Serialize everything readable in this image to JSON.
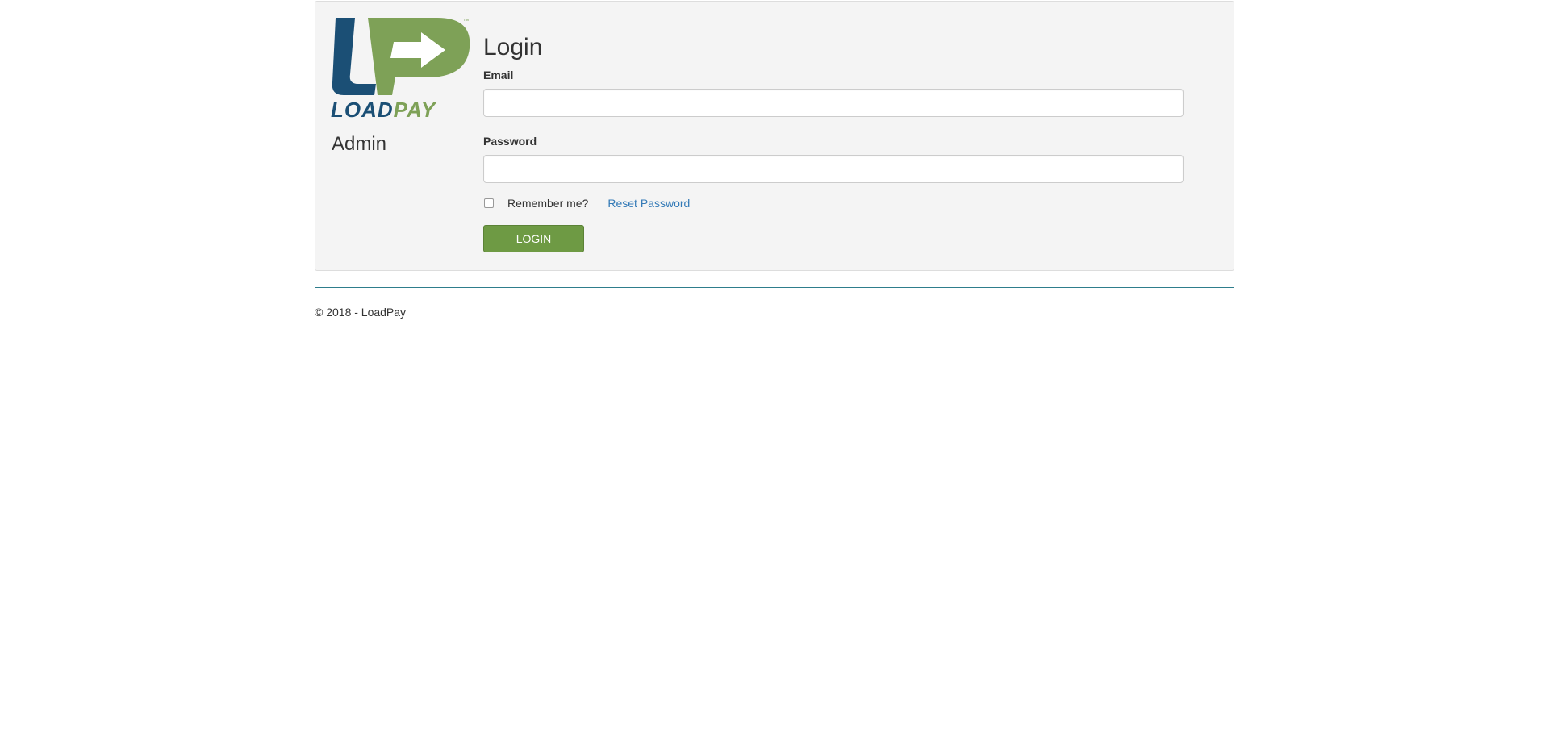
{
  "brand": {
    "logo_text": "LOADPAY",
    "logo_initials": "LP",
    "logo_trademark": "™",
    "section_label": "Admin",
    "colors": {
      "blue": "#1b4f75",
      "green": "#7ea157"
    }
  },
  "form": {
    "title": "Login",
    "email_label": "Email",
    "email_value": "",
    "password_label": "Password",
    "password_value": "",
    "remember_label": "Remember me?",
    "remember_checked": false,
    "reset_link": "Reset Password",
    "submit_label": "LOGIN"
  },
  "footer": {
    "copyright": "© 2018 - LoadPay"
  },
  "colors": {
    "panel_bg": "#f4f4f4",
    "button": "#6e9a44",
    "link": "#337ab7",
    "footer_rule": "#2e7d8c"
  }
}
